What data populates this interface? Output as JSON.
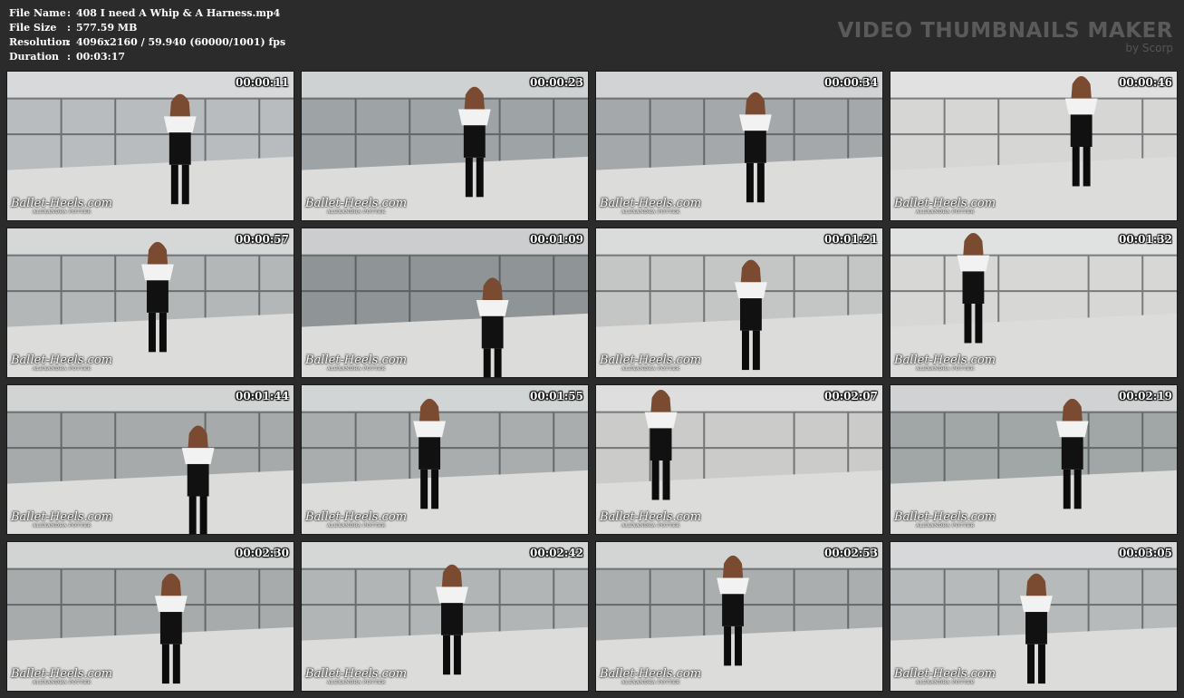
{
  "info": {
    "file_name": {
      "label": "File Name",
      "sep": ":",
      "value": "408 I need A Whip & A Harness.mp4"
    },
    "file_size": {
      "label": "File Size",
      "sep": ":",
      "value": "577.59 MB"
    },
    "resolution": {
      "label": "Resolution",
      "sep": ":",
      "value": "4096x2160 / 59.940 (60000/1001) fps"
    },
    "duration": {
      "label": "Duration",
      "sep": ":",
      "value": "00:03:17"
    }
  },
  "brand": {
    "title": "VIDEO THUMBNAILS MAKER",
    "subtitle": "by Scorp"
  },
  "watermark": {
    "main": "Ballet-Heels.com",
    "sub": "ALEXANDRA POTTER"
  },
  "thumbnails": [
    {
      "time": "00:00:11"
    },
    {
      "time": "00:00:23"
    },
    {
      "time": "00:00:34"
    },
    {
      "time": "00:00:46"
    },
    {
      "time": "00:00:57"
    },
    {
      "time": "00:01:09"
    },
    {
      "time": "00:01:21"
    },
    {
      "time": "00:01:32"
    },
    {
      "time": "00:01:44"
    },
    {
      "time": "00:01:55"
    },
    {
      "time": "00:02:07"
    },
    {
      "time": "00:02:19"
    },
    {
      "time": "00:02:30"
    },
    {
      "time": "00:02:42"
    },
    {
      "time": "00:02:53"
    },
    {
      "time": "00:03:05"
    }
  ],
  "colors": {
    "background": "#2b2b2b",
    "info_text": "#ffffff",
    "brand_text": "#5a5a5a"
  }
}
